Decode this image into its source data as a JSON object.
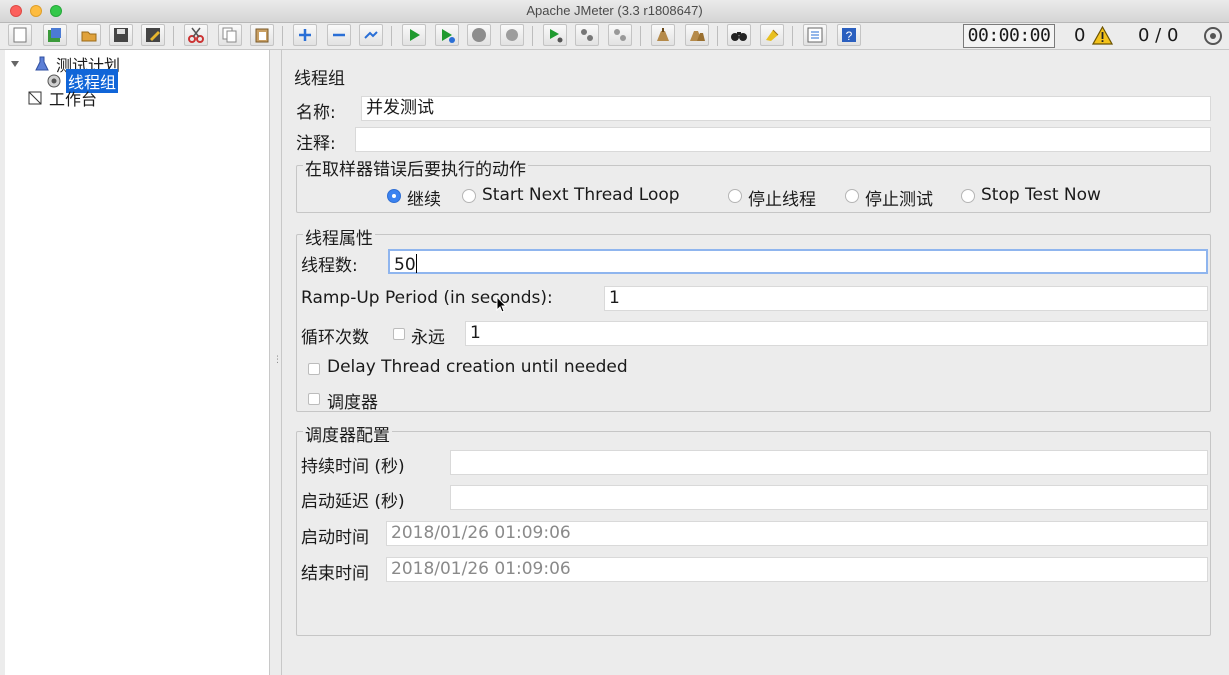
{
  "window": {
    "title": "Apache JMeter (3.3 r1808647)"
  },
  "toolbar": {
    "buttons": [
      "new-icon",
      "templates-icon",
      "open-icon",
      "save-icon",
      "save-as-icon",
      "cut-icon",
      "copy-icon",
      "paste-icon",
      "expand-icon",
      "collapse-icon",
      "toggle-icon",
      "start-icon",
      "start-no-pause-icon",
      "stop-icon",
      "shutdown-icon",
      "remote-start-icon",
      "remote-stop-icon",
      "remote-shutdown-icon",
      "clear-icon",
      "clear-all-icon",
      "search-icon",
      "reset-search-icon",
      "function-helper-icon",
      "help-icon"
    ],
    "timer": "00:00:00",
    "error_count": "0",
    "thread_count": "0 / 0"
  },
  "tree": {
    "test_plan": "测试计划",
    "thread_group": "线程组",
    "workbench": "工作台"
  },
  "form": {
    "title": "线程组",
    "name_label": "名称:",
    "name_value": "并发测试",
    "comment_label": "注释:",
    "comment_value": "",
    "error_action": {
      "title": "在取样器错误后要执行的动作",
      "options": [
        "继续",
        "Start Next Thread Loop",
        "停止线程",
        "停止测试",
        "Stop Test Now"
      ],
      "selected": "继续"
    },
    "thread_props": {
      "title": "线程属性",
      "threads_label": "线程数:",
      "threads_value": "50",
      "rampup_label": "Ramp-Up Period (in seconds):",
      "rampup_value": "1",
      "loop_label": "循环次数",
      "forever_label": "永远",
      "loop_value": "1",
      "delay_label": "Delay Thread creation until needed",
      "scheduler_label": "调度器"
    },
    "scheduler": {
      "title": "调度器配置",
      "duration_label": "持续时间 (秒)",
      "duration_value": "",
      "delay_label": "启动延迟 (秒)",
      "delay_value": "",
      "start_label": "启动时间",
      "start_value": "2018/01/26 01:09:06",
      "end_label": "结束时间",
      "end_value": "2018/01/26 01:09:06"
    }
  },
  "colors": {
    "selection": "#1065d8",
    "radio_on": "#3b82f0",
    "focus_border": "#8fb5ee"
  }
}
